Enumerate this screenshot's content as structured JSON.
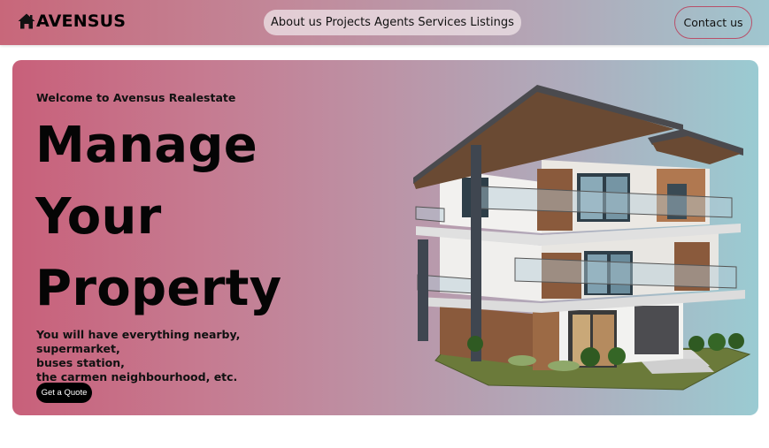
{
  "brand": {
    "name": "AVENSUS",
    "icon": "home-icon"
  },
  "nav": {
    "items": [
      "About us",
      "Projects",
      "Agents",
      "Services",
      "Listings"
    ]
  },
  "header": {
    "contact_label": "Contact us"
  },
  "hero": {
    "welcome": "Welcome to Avensus Realestate",
    "headline": [
      "Manage",
      "Your",
      "Property"
    ],
    "subtext": [
      "You will have everything nearby, supermarket,",
      "buses station,",
      "the carmen neighbourhood, etc."
    ],
    "cta_label": "Get a Quote",
    "image": "modern-house-image"
  },
  "colors": {
    "accent": "#c8607a",
    "teal": "#9acbd2",
    "button": "#000000"
  }
}
